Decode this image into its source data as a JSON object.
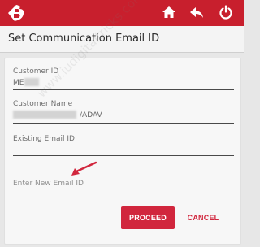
{
  "header": {
    "logo_icon": "bank-of-baroda-logo",
    "home_icon": "home-icon",
    "back_icon": "back-arrow-icon",
    "power_icon": "power-icon",
    "brand_color": "#c81f2d"
  },
  "page": {
    "title": "Set Communication Email ID"
  },
  "form": {
    "customer_id_label": "Customer ID",
    "customer_id_value": "ME",
    "customer_name_label": "Customer Name",
    "customer_name_value": "/ADAV",
    "existing_email_label": "Existing Email ID",
    "existing_email_value": "",
    "new_email_placeholder": "Enter New Email ID",
    "new_email_value": ""
  },
  "buttons": {
    "proceed_label": "PROCEED",
    "cancel_label": "CANCEL",
    "accent_color": "#d1263d"
  },
  "overlay": {
    "watermark_text": "www.iudigitaltricks.com",
    "arrow_icon": "red-arrow-icon"
  }
}
